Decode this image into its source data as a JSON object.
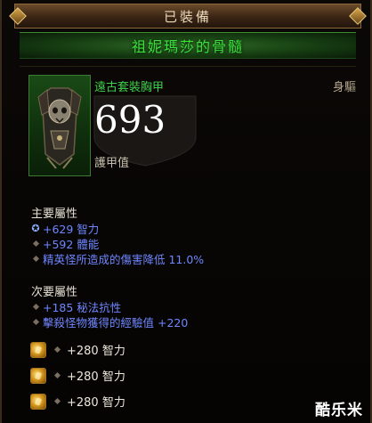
{
  "header": {
    "equipped_label": "已裝備"
  },
  "item": {
    "name": "祖妮瑪莎的骨髓",
    "type": "遠古套裝胸甲",
    "slot": "身驅",
    "armor_value": "693",
    "armor_label": "護甲值",
    "icon": "skull-chest-armor-icon"
  },
  "primary": {
    "title": "主要屬性",
    "stats": [
      {
        "text": "+629 智力",
        "bullet": "swirl-icon"
      },
      {
        "text": "+592 體能",
        "bullet": "diamond-bullet-icon"
      },
      {
        "text": "精英怪所造成的傷害降低 11.0%",
        "bullet": "diamond-bullet-icon"
      }
    ]
  },
  "secondary": {
    "title": "次要屬性",
    "stats": [
      {
        "text": "+185 秘法抗性",
        "bullet": "diamond-bullet-icon"
      },
      {
        "text": "擊殺怪物獲得的經驗值 +220",
        "bullet": "diamond-bullet-icon"
      }
    ]
  },
  "sockets": [
    {
      "text": "+280 智力",
      "gem": "topaz-gem-icon"
    },
    {
      "text": "+280 智力",
      "gem": "topaz-gem-icon"
    },
    {
      "text": "+280 智力",
      "gem": "topaz-gem-icon"
    }
  ],
  "watermark": "酷乐米",
  "colors": {
    "set_green": "#3fd04a",
    "item_name_green": "#39e23a",
    "magic_blue": "#6f86ff",
    "armor_white": "#ffffff"
  }
}
